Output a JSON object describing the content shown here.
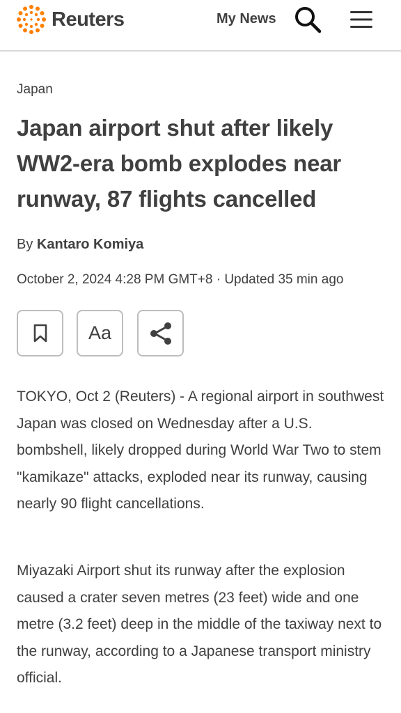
{
  "header": {
    "brand": "Reuters",
    "my_news_label": "My News",
    "search_icon": "search-icon",
    "menu_icon": "hamburger-menu-icon",
    "brand_color": "#ff8000"
  },
  "article": {
    "section": "Japan",
    "headline": "Japan airport shut after likely WW2-era bomb explodes near runway, 87 flights cancelled",
    "byline_prefix": "By",
    "author": "Kantaro Komiya",
    "dateline": "October 2, 2024 4:28 PM GMT+8 · Updated 35 min ago",
    "tools": {
      "bookmark_icon": "bookmark-icon",
      "text_size_label": "Aa",
      "share_icon": "share-icon"
    },
    "paragraphs": [
      "TOKYO, Oct 2 (Reuters) - A regional airport in southwest Japan was closed on Wednesday after a U.S. bombshell, likely dropped during World War Two to stem \"kamikaze\" attacks, exploded near its runway, causing nearly 90 flight cancellations.",
      "Miyazaki Airport shut its runway after the explosion caused a crater seven metres (23 feet) wide and one metre (3.2 feet) deep in the middle of the taxiway next to the runway, according to a Japanese transport ministry official."
    ]
  }
}
